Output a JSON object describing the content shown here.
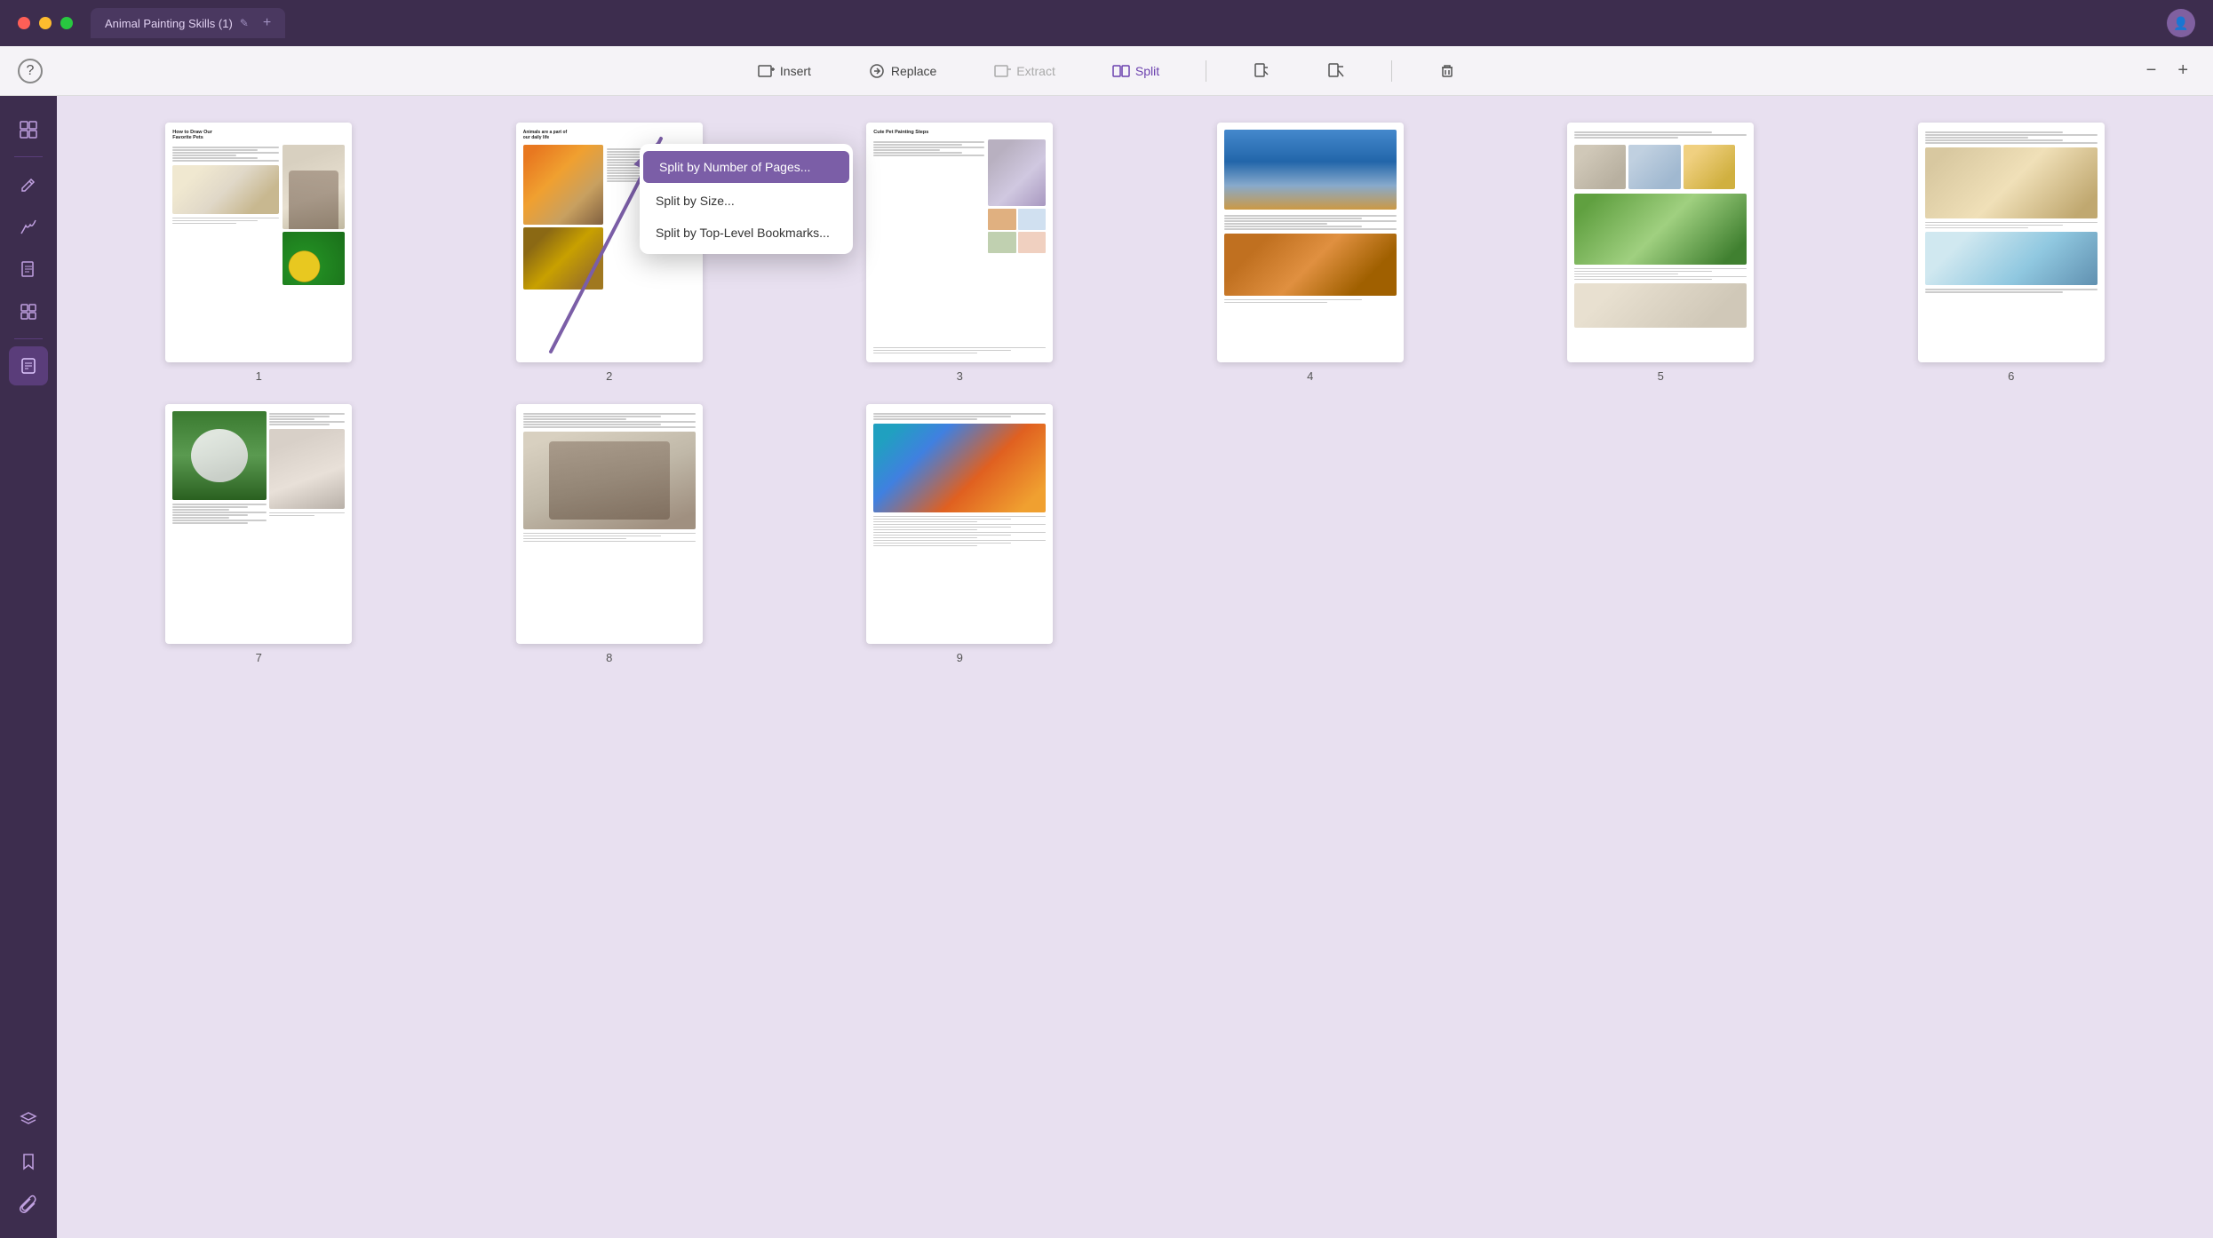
{
  "app": {
    "title": "Animal Painting Skills (1)",
    "tab_label": "Animal Painting Skills (1)"
  },
  "titlebar": {
    "traffic_lights": [
      "red",
      "yellow",
      "green"
    ]
  },
  "toolbar": {
    "help_label": "?",
    "insert_label": "Insert",
    "replace_label": "Replace",
    "extract_label": "Extract",
    "split_label": "Split",
    "icon1_label": "",
    "icon2_label": "",
    "delete_label": "",
    "zoom_out_label": "−",
    "zoom_in_label": "+"
  },
  "dropdown": {
    "item1": "Split by Number of Pages...",
    "item2": "Split by Size...",
    "item3": "Split by Top-Level Bookmarks..."
  },
  "sidebar": {
    "items": [
      {
        "name": "thumbnails",
        "icon": "⊞"
      },
      {
        "name": "edit",
        "icon": "✏"
      },
      {
        "name": "annotate",
        "icon": "✍"
      },
      {
        "name": "pages",
        "icon": "⊡"
      },
      {
        "name": "organize",
        "icon": "⊟"
      },
      {
        "name": "active-tool",
        "icon": "⊡"
      },
      {
        "name": "layers",
        "icon": "⊕"
      },
      {
        "name": "bookmarks",
        "icon": "🔖"
      },
      {
        "name": "attachments",
        "icon": "📎"
      }
    ]
  },
  "pages": [
    {
      "number": "1",
      "title": "How to Draw Our Favorite Pets"
    },
    {
      "number": "2",
      "title": "Animals are a part of our daily life"
    },
    {
      "number": "3",
      "title": "Cute Pet Painting Steps"
    },
    {
      "number": "4",
      "title": ""
    },
    {
      "number": "5",
      "title": ""
    },
    {
      "number": "6",
      "title": ""
    },
    {
      "number": "7",
      "title": ""
    },
    {
      "number": "8",
      "title": ""
    },
    {
      "number": "9",
      "title": ""
    }
  ]
}
